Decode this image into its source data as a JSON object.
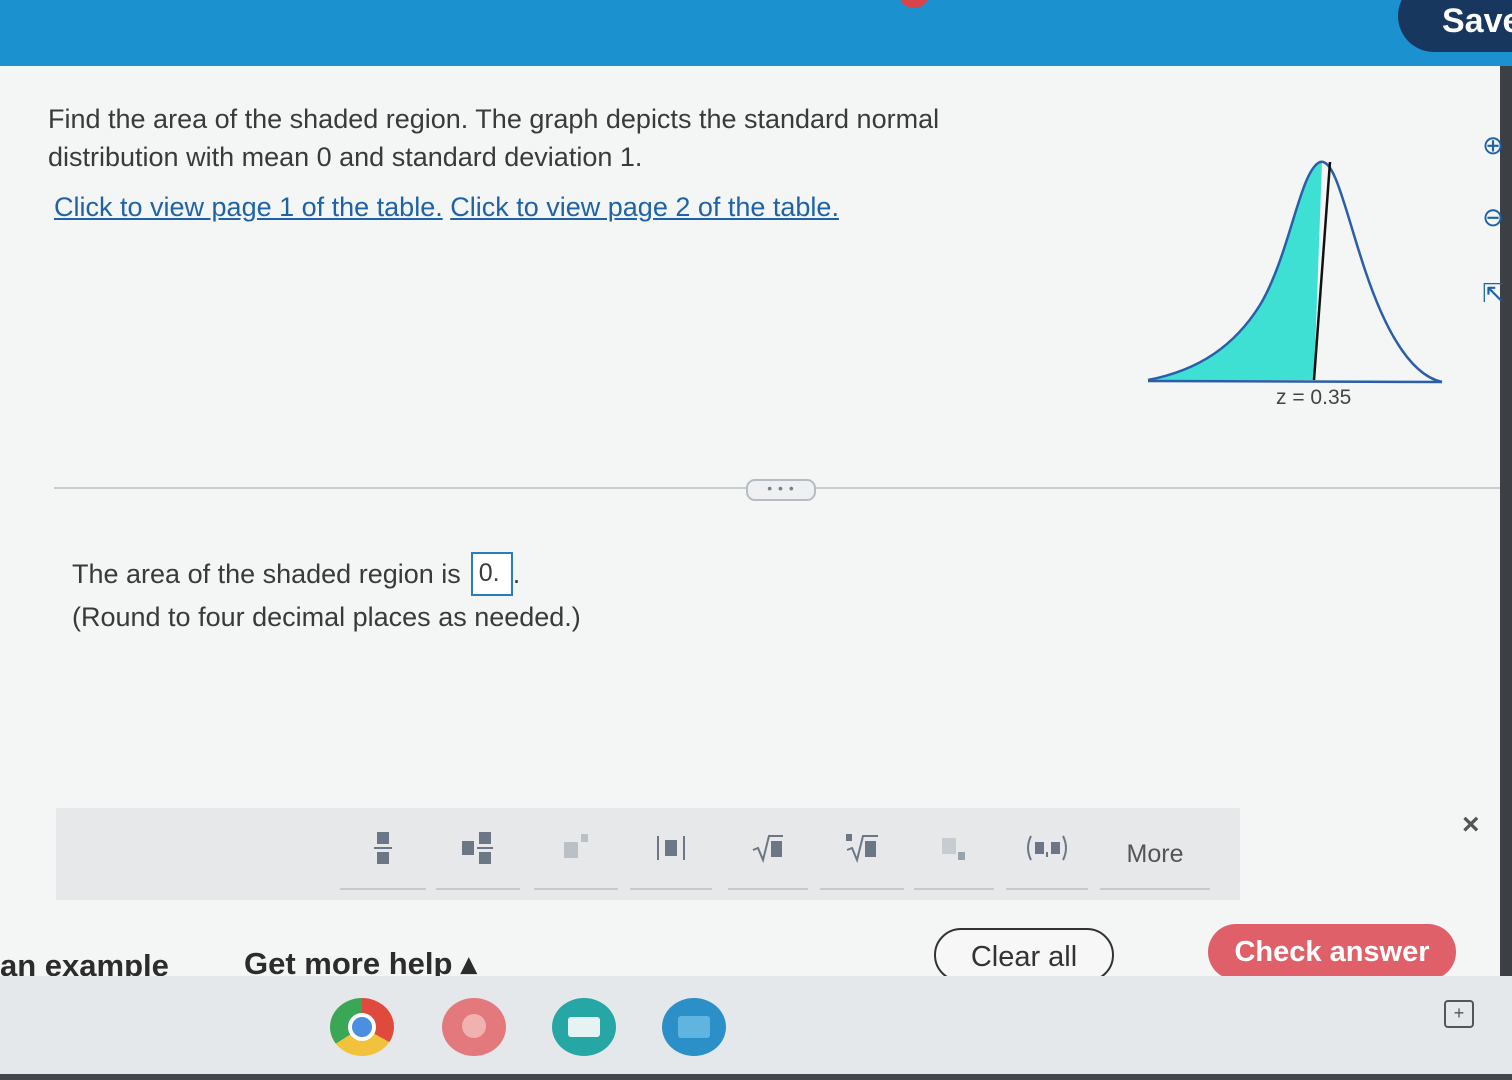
{
  "header": {
    "save_label": "Save"
  },
  "question": {
    "line1": "Find the area of the shaded region. The graph depicts the standard normal",
    "line2": "distribution with mean 0 and standard deviation 1.",
    "link1": "Click to view page 1 of the table.",
    "link2": "Click to view page 2 of the table."
  },
  "graph": {
    "z_label": "z = 0.35",
    "fill_color": "#3ee0d3",
    "curve_color": "#2a5ea8"
  },
  "divider": {
    "handle": "• • •"
  },
  "answer": {
    "prefix": "The area of the shaded region is",
    "value": "0.",
    "suffix": ".",
    "hint": "(Round to four decimal places as needed.)"
  },
  "toolbar": {
    "tools": [
      "fraction-tool",
      "mixed-number-tool",
      "exponent-tool",
      "absolute-value-tool",
      "square-root-tool",
      "nth-root-tool",
      "subscript-tool",
      "ordered-pair-tool"
    ],
    "more_label": "More",
    "close_label": "×"
  },
  "footer": {
    "example_label": "an example",
    "help_label": "Get more help ▴",
    "clear_label": "Clear all",
    "check_label": "Check answer"
  },
  "colors": {
    "topbar": "#1b91cf",
    "save": "#17375e",
    "check": "#e0606a",
    "link": "#1e63a8"
  }
}
